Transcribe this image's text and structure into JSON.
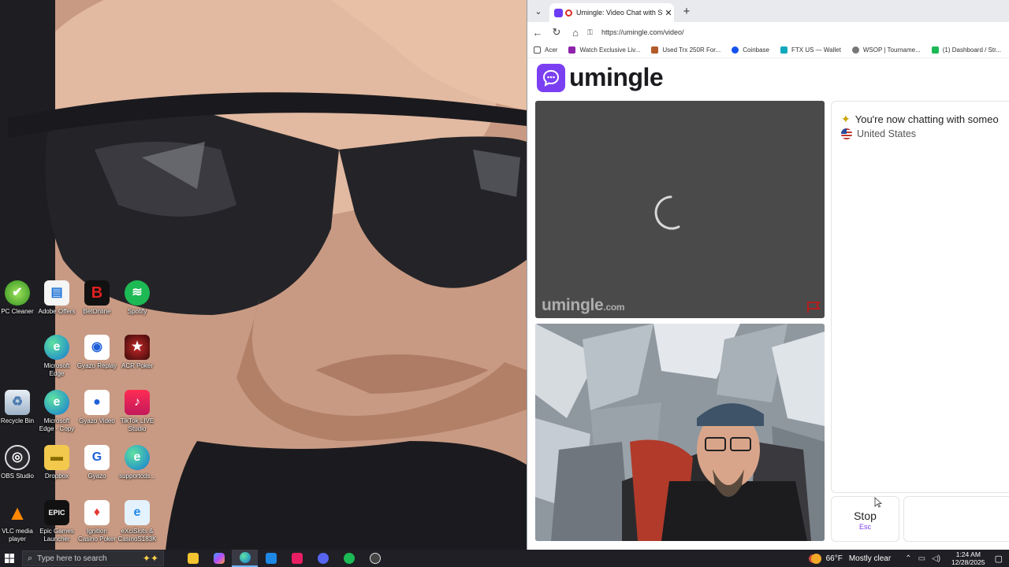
{
  "desktop": {
    "icons": [
      {
        "label": "PC Cleaner"
      },
      {
        "label": "Adobe Offers"
      },
      {
        "label": "BetOnline"
      },
      {
        "label": "Spotify"
      },
      {
        "label": "Microsoft Edge"
      },
      {
        "label": "Gyazo Replay"
      },
      {
        "label": "ACR Poker"
      },
      {
        "label": "Recycle Bin"
      },
      {
        "label": "Microsoft Edge - Copy"
      },
      {
        "label": "Gyazo Video"
      },
      {
        "label": "TikTok LIVE Studio"
      },
      {
        "label": "OBS Studio"
      },
      {
        "label": "Dropbox"
      },
      {
        "label": "Gyazo"
      },
      {
        "label": "supportcds..."
      },
      {
        "label": "VLC media player"
      },
      {
        "label": "Epic Games Launcher"
      },
      {
        "label": "Ignition Casino Poker"
      },
      {
        "label": "eXciSlots & CasinoS183K"
      }
    ]
  },
  "browser": {
    "tab_title": "Umingle: Video Chat with Stra",
    "url": "https://umingle.com/video/",
    "bookmarks": [
      {
        "label": "Acer",
        "color": "#555555"
      },
      {
        "label": "Watch Exclusive Liv...",
        "color": "#8e24aa"
      },
      {
        "label": "Used Trx 250R For...",
        "color": "#b35a2b"
      },
      {
        "label": "Coinbase",
        "color": "#1652f0"
      },
      {
        "label": "FTX US — Wallet",
        "color": "#11a9bc"
      },
      {
        "label": "WSOP | Tourname...",
        "color": "#777777"
      },
      {
        "label": "(1) Dashboard / Str...",
        "color": "#1db954"
      }
    ]
  },
  "page": {
    "brand": "umingle",
    "brand_color": "#7b3ff2",
    "watermark": "umingle",
    "watermark_suffix": ".com",
    "chat_status": "You're now chatting with someo",
    "chat_country": "United States",
    "stop_label": "Stop",
    "stop_key": "Esc"
  },
  "taskbar": {
    "search_placeholder": "Type here to search",
    "apps": [
      {
        "name": "file-explorer",
        "color": "#f4c430"
      },
      {
        "name": "copilot",
        "color": "#7a5cff"
      },
      {
        "name": "edge",
        "color": "#2bb673"
      },
      {
        "name": "store",
        "color": "#1e88e5"
      },
      {
        "name": "tiktok",
        "color": "#e91e63"
      },
      {
        "name": "discord",
        "color": "#5865f2"
      },
      {
        "name": "spotify",
        "color": "#1db954"
      },
      {
        "name": "obs",
        "color": "#444444"
      }
    ],
    "weather_temp": "66°F",
    "weather_desc": "Mostly clear",
    "time": "1:24 AM",
    "date": "12/28/2025"
  }
}
